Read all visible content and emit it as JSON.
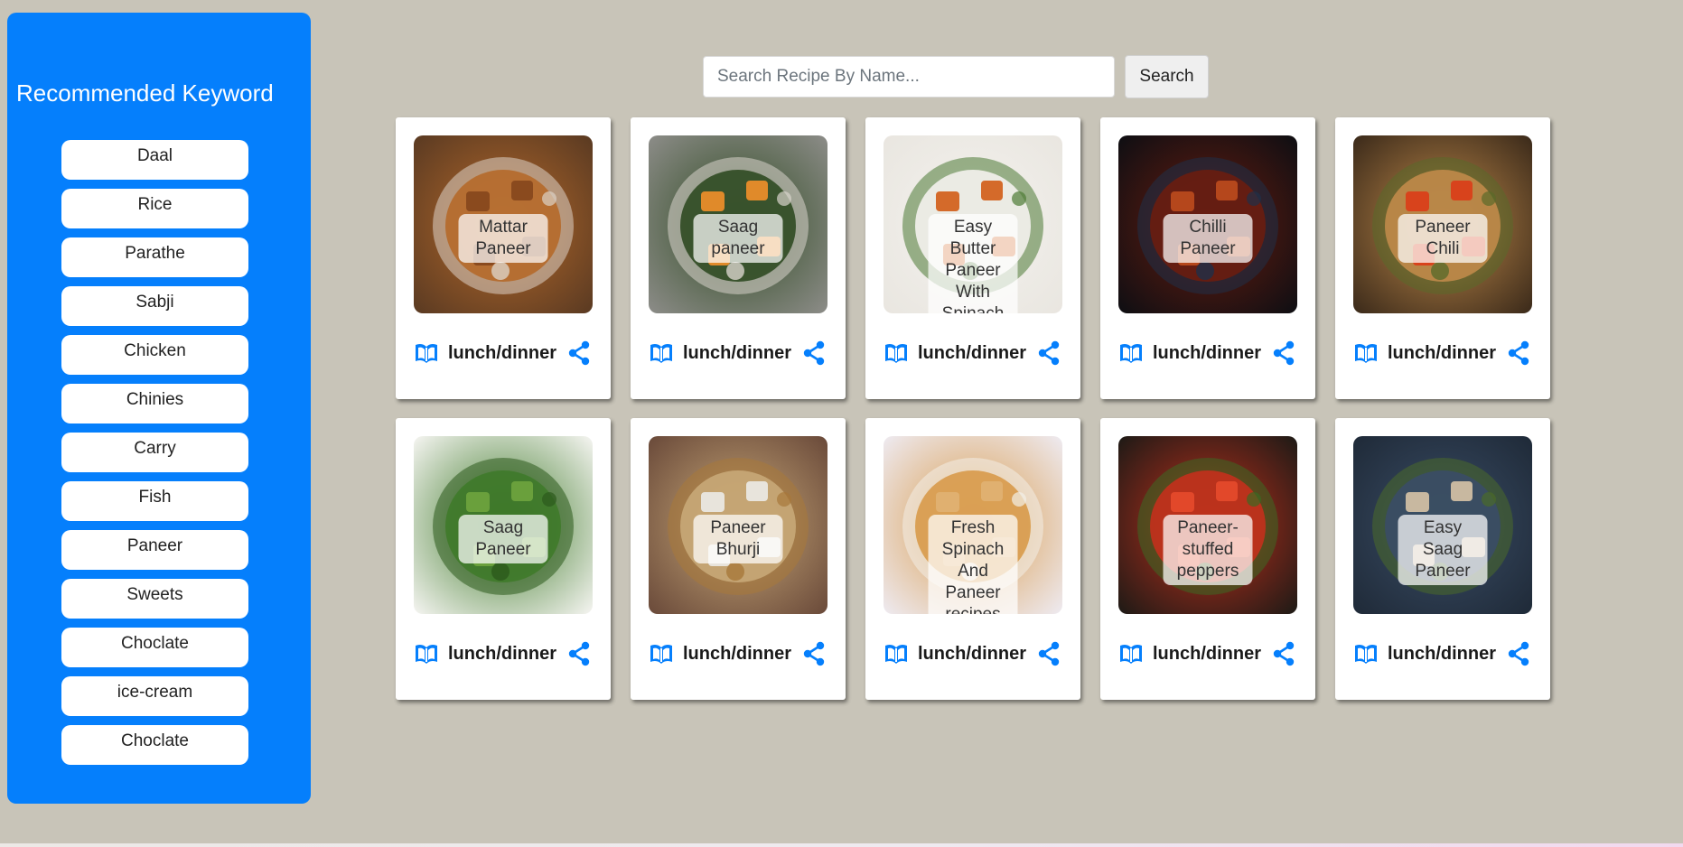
{
  "sidebar": {
    "title": "Recommended Keyword",
    "keywords": [
      "Daal",
      "Rice",
      "Parathe",
      "Sabji",
      "Chicken",
      "Chinies",
      "Carry",
      "Fish",
      "Paneer",
      "Sweets",
      "Choclate",
      "ice-cream",
      "Choclate"
    ]
  },
  "search": {
    "placeholder": "Search Recipe By Name...",
    "value": "",
    "button_label": "Search"
  },
  "recipes": [
    {
      "title": "Mattar Paneer",
      "tag": "lunch/dinner",
      "palette": [
        "#5a3a22",
        "#b5692a",
        "#8a4a1e",
        "#dcd2c6"
      ]
    },
    {
      "title": "Saag paneer",
      "tag": "lunch/dinner",
      "palette": [
        "#8c8c88",
        "#2f4a22",
        "#e08a2a",
        "#d9d4cc"
      ]
    },
    {
      "title": "Easy Butter Paneer With Spinach Recipe",
      "tag": "lunch/dinner",
      "palette": [
        "#e9e6e0",
        "#f4f2ee",
        "#d46a2a",
        "#4d7a34"
      ]
    },
    {
      "title": "Chilli Paneer",
      "tag": "lunch/dinner",
      "palette": [
        "#0e0e12",
        "#6a1d10",
        "#b5471c",
        "#1f3048"
      ]
    },
    {
      "title": "Paneer Chili",
      "tag": "lunch/dinner",
      "palette": [
        "#3b2a1a",
        "#c08a4a",
        "#d8431c",
        "#5a6a2a"
      ]
    },
    {
      "title": "Saag Paneer",
      "tag": "lunch/dinner",
      "palette": [
        "#f4f4f0",
        "#3f7a2a",
        "#6aa03c",
        "#2c5a1c"
      ]
    },
    {
      "title": "Paneer Bhurji",
      "tag": "lunch/dinner",
      "palette": [
        "#6a4a3a",
        "#c8a878",
        "#e8e4dc",
        "#a8783a"
      ]
    },
    {
      "title": "Fresh Spinach And Paneer recipes",
      "tag": "lunch/dinner",
      "palette": [
        "#eeeaf0",
        "#d89a4a",
        "#e0b070",
        "#f2efe8"
      ]
    },
    {
      "title": "Paneer-stuffed peppers",
      "tag": "lunch/dinner",
      "palette": [
        "#1e1a16",
        "#c4301c",
        "#e2482a",
        "#3a6a22"
      ]
    },
    {
      "title": "Easy Saag Paneer",
      "tag": "lunch/dinner",
      "palette": [
        "#1f2a38",
        "#3a4d66",
        "#c8b8a0",
        "#4a6a2a"
      ]
    }
  ],
  "colors": {
    "accent": "#057ffc",
    "background": "#c8c4b8",
    "card": "#ffffff"
  },
  "icons": {
    "tag_icon": "book-open-icon",
    "share_icon": "share-icon"
  }
}
